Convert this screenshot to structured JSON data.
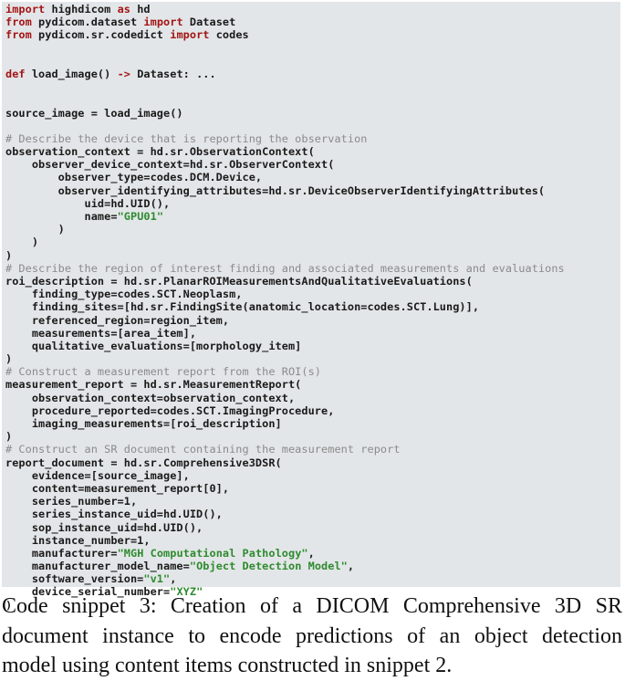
{
  "code_snippet": {
    "colors": {
      "background": "#e3e6e8",
      "keyword": "#a31515",
      "string": "#2e8b2e",
      "comment": "#8a8a8a",
      "text": "#1a1a1a"
    },
    "lines": [
      [
        {
          "t": "kw",
          "v": "import"
        },
        {
          "t": "plain",
          "v": " highdicom "
        },
        {
          "t": "kw",
          "v": "as"
        },
        {
          "t": "plain",
          "v": " hd"
        }
      ],
      [
        {
          "t": "kw",
          "v": "from"
        },
        {
          "t": "plain",
          "v": " pydicom.dataset "
        },
        {
          "t": "kw",
          "v": "import"
        },
        {
          "t": "plain",
          "v": " Dataset"
        }
      ],
      [
        {
          "t": "kw",
          "v": "from"
        },
        {
          "t": "plain",
          "v": " pydicom.sr.codedict "
        },
        {
          "t": "kw",
          "v": "import"
        },
        {
          "t": "plain",
          "v": " codes"
        }
      ],
      [],
      [],
      [
        {
          "t": "kw",
          "v": "def"
        },
        {
          "t": "plain",
          "v": " load_image() "
        },
        {
          "t": "kw",
          "v": "->"
        },
        {
          "t": "plain",
          "v": " Dataset: ..."
        }
      ],
      [],
      [],
      [
        {
          "t": "plain",
          "v": "source_image = load_image()"
        }
      ],
      [],
      [
        {
          "t": "com",
          "v": "# Describe the device that is reporting the observation"
        }
      ],
      [
        {
          "t": "plain",
          "v": "observation_context = hd.sr.ObservationContext("
        }
      ],
      [
        {
          "t": "plain",
          "v": "    observer_device_context=hd.sr.ObserverContext("
        }
      ],
      [
        {
          "t": "plain",
          "v": "        observer_type=codes.DCM.Device,"
        }
      ],
      [
        {
          "t": "plain",
          "v": "        observer_identifying_attributes=hd.sr.DeviceObserverIdentifyingAttributes("
        }
      ],
      [
        {
          "t": "plain",
          "v": "            uid=hd.UID(),"
        }
      ],
      [
        {
          "t": "plain",
          "v": "            name="
        },
        {
          "t": "str",
          "v": "\"GPU01\""
        }
      ],
      [
        {
          "t": "plain",
          "v": "        )"
        }
      ],
      [
        {
          "t": "plain",
          "v": "    )"
        }
      ],
      [
        {
          "t": "plain",
          "v": ")"
        }
      ],
      [
        {
          "t": "com",
          "v": "# Describe the region of interest finding and associated measurements and evaluations"
        }
      ],
      [
        {
          "t": "plain",
          "v": "roi_description = hd.sr.PlanarROIMeasurementsAndQualitativeEvaluations("
        }
      ],
      [
        {
          "t": "plain",
          "v": "    finding_type=codes.SCT.Neoplasm,"
        }
      ],
      [
        {
          "t": "plain",
          "v": "    finding_sites=[hd.sr.FindingSite(anatomic_location=codes.SCT.Lung)],"
        }
      ],
      [
        {
          "t": "plain",
          "v": "    referenced_region=region_item,"
        }
      ],
      [
        {
          "t": "plain",
          "v": "    measurements=[area_item],"
        }
      ],
      [
        {
          "t": "plain",
          "v": "    qualitative_evaluations=[morphology_item]"
        }
      ],
      [
        {
          "t": "plain",
          "v": ")"
        }
      ],
      [
        {
          "t": "com",
          "v": "# Construct a measurement report from the ROI(s)"
        }
      ],
      [
        {
          "t": "plain",
          "v": "measurement_report = hd.sr.MeasurementReport("
        }
      ],
      [
        {
          "t": "plain",
          "v": "    observation_context=observation_context,"
        }
      ],
      [
        {
          "t": "plain",
          "v": "    procedure_reported=codes.SCT.ImagingProcedure,"
        }
      ],
      [
        {
          "t": "plain",
          "v": "    imaging_measurements=[roi_description]"
        }
      ],
      [
        {
          "t": "plain",
          "v": ")"
        }
      ],
      [
        {
          "t": "com",
          "v": "# Construct an SR document containing the measurement report"
        }
      ],
      [
        {
          "t": "plain",
          "v": "report_document = hd.sr.Comprehensive3DSR("
        }
      ],
      [
        {
          "t": "plain",
          "v": "    evidence=[source_image],"
        }
      ],
      [
        {
          "t": "plain",
          "v": "    content=measurement_report[0],"
        }
      ],
      [
        {
          "t": "plain",
          "v": "    series_number=1,"
        }
      ],
      [
        {
          "t": "plain",
          "v": "    series_instance_uid=hd.UID(),"
        }
      ],
      [
        {
          "t": "plain",
          "v": "    sop_instance_uid=hd.UID(),"
        }
      ],
      [
        {
          "t": "plain",
          "v": "    instance_number=1,"
        }
      ],
      [
        {
          "t": "plain",
          "v": "    manufacturer="
        },
        {
          "t": "str",
          "v": "\"MGH Computational Pathology\""
        },
        {
          "t": "plain",
          "v": ","
        }
      ],
      [
        {
          "t": "plain",
          "v": "    manufacturer_model_name="
        },
        {
          "t": "str",
          "v": "\"Object Detection Model\""
        },
        {
          "t": "plain",
          "v": ","
        }
      ],
      [
        {
          "t": "plain",
          "v": "    software_version="
        },
        {
          "t": "str",
          "v": "\"v1\""
        },
        {
          "t": "plain",
          "v": ","
        }
      ],
      [
        {
          "t": "plain",
          "v": "    device_serial_number="
        },
        {
          "t": "str",
          "v": "\"XYZ\""
        }
      ],
      [
        {
          "t": "plain",
          "v": ")"
        }
      ]
    ]
  },
  "caption": {
    "lines": [
      "Code snippet 3:  Creation of a DICOM Comprehensive 3D SR",
      "document instance to encode  predictions of an object detection",
      "model using content items constructed in snippet 2."
    ]
  }
}
